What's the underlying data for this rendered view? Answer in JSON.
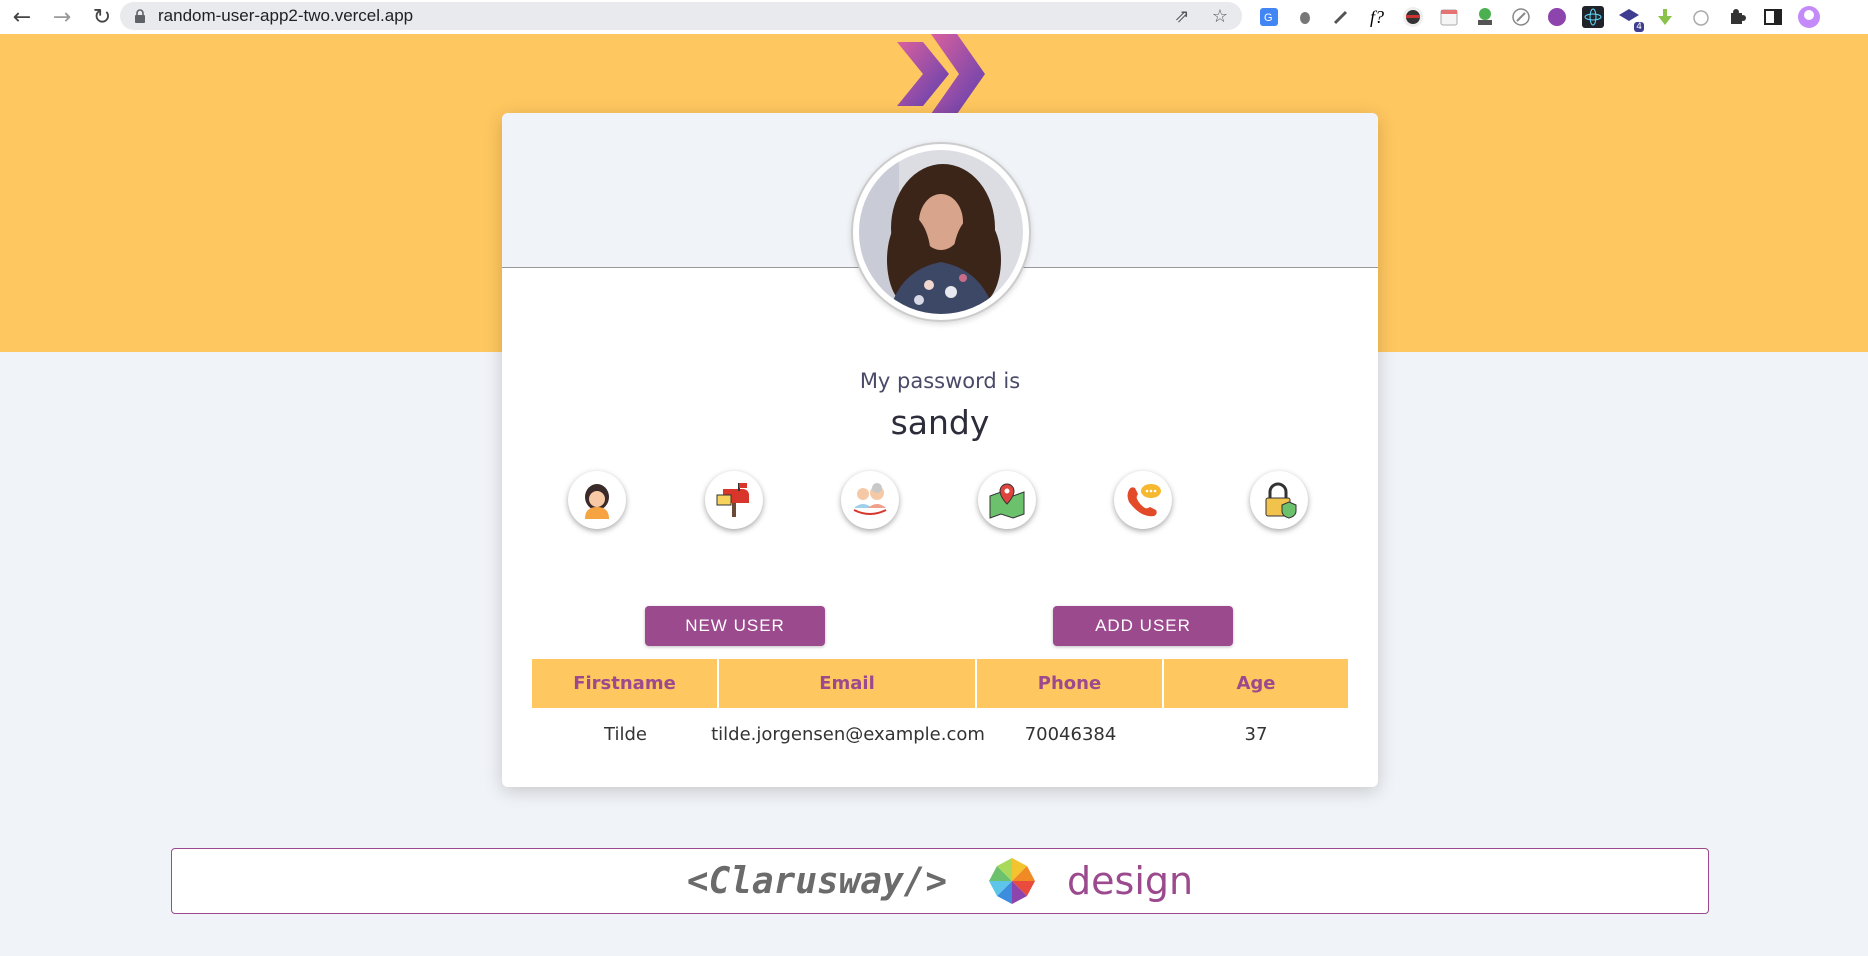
{
  "browser": {
    "url": "random-user-app2-two.vercel.app",
    "extensions": [
      "translate-icon",
      "bug-icon",
      "eyedropper-icon",
      "font-icon",
      "ninja-icon",
      "calendar-icon",
      "html-icon",
      "compass-icon",
      "circle-icon",
      "react-icon",
      "graduation-icon",
      "download-icon",
      "timer-icon",
      "puzzle-icon",
      "sidebar-icon",
      "profile-icon"
    ],
    "ext_badge": "4"
  },
  "card": {
    "label": "My password is",
    "value": "sandy",
    "icons": [
      "woman-icon",
      "mailbox-icon",
      "elderly-couple-icon",
      "map-icon",
      "phone-icon",
      "padlock-icon"
    ]
  },
  "buttons": {
    "new_user": "NEW USER",
    "add_user": "ADD USER"
  },
  "table": {
    "headers": [
      "Firstname",
      "Email",
      "Phone",
      "Age"
    ],
    "rows": [
      {
        "firstname": "Tilde",
        "email": "tilde.jorgensen@example.com",
        "phone": "70046384",
        "age": "37"
      }
    ]
  },
  "footer": {
    "brand": "<Clarusway/>",
    "suffix": "design"
  },
  "colors": {
    "accent": "#ffc75f",
    "purple": "#9b4a8e",
    "background": "#f0f3f7"
  }
}
